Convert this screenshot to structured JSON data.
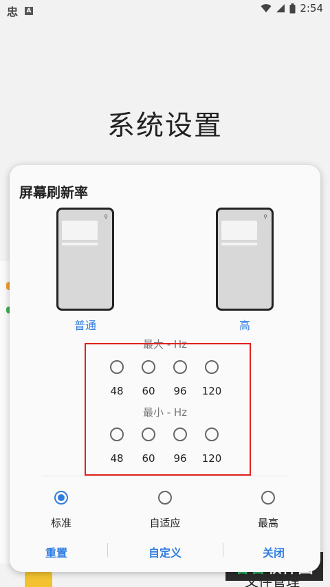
{
  "status_bar": {
    "time": "2:54",
    "app_glyph": "忠",
    "badge": "A"
  },
  "background": {
    "title": "系统设置",
    "bottom_label": "文件管理",
    "watermark_a": "谷普",
    "watermark_b": "软件园"
  },
  "dialog": {
    "title": "屏幕刷新率",
    "phones": [
      {
        "label": "普通"
      },
      {
        "label": "高"
      }
    ],
    "max_label": "最大 - Hz",
    "min_label": "最小 - Hz",
    "max_options": [
      "48",
      "60",
      "96",
      "120"
    ],
    "min_options": [
      "48",
      "60",
      "96",
      "120"
    ],
    "modes": [
      {
        "label": "标准",
        "selected": true
      },
      {
        "label": "自适应",
        "selected": false
      },
      {
        "label": "最高",
        "selected": false
      }
    ],
    "buttons": {
      "reset": "重置",
      "custom": "自定义",
      "close": "关闭"
    },
    "accent_color": "#2f7de1",
    "highlight_color": "#e0211d"
  }
}
